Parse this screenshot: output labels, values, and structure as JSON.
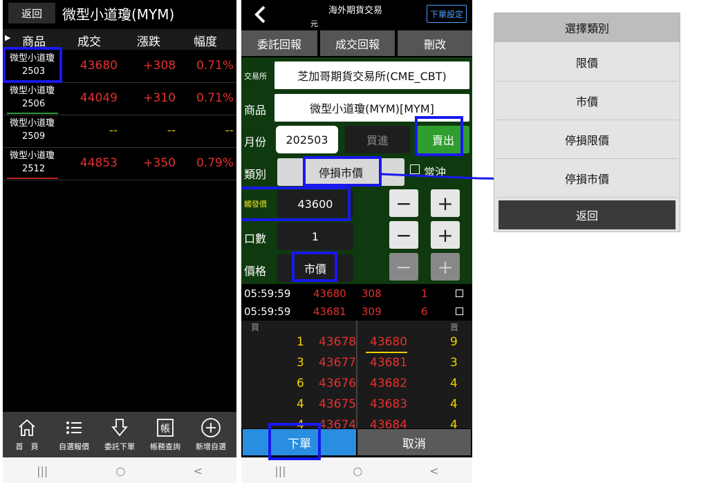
{
  "left": {
    "back_label": "返回",
    "title": "微型小道瓊(MYM)",
    "columns": [
      "商品",
      "成交",
      "漲跌",
      "幅度"
    ],
    "rows": [
      {
        "name": "微型小道瓊",
        "month": "2503",
        "price": "43680",
        "change": "+308",
        "pct": "0.71%"
      },
      {
        "name": "微型小道瓊",
        "month": "2506",
        "price": "44049",
        "change": "+310",
        "pct": "0.71%"
      },
      {
        "name": "微型小道瓊",
        "month": "2509",
        "price": "--",
        "change": "--",
        "pct": "--"
      },
      {
        "name": "微型小道瓊",
        "month": "2512",
        "price": "44853",
        "change": "+350",
        "pct": "0.79%"
      }
    ],
    "nav": [
      {
        "label": "首　頁",
        "icon": "home-icon"
      },
      {
        "label": "自選報價",
        "icon": "list-icon"
      },
      {
        "label": "委託下單",
        "icon": "order-icon"
      },
      {
        "label": "帳務查詢",
        "icon": "account-icon"
      },
      {
        "label": "新增自選",
        "icon": "plus-circle-icon"
      }
    ],
    "sys": [
      "|||",
      "○",
      "<"
    ]
  },
  "middle": {
    "title": "海外期貨交易",
    "currency": "元",
    "settings_label": "下單設定",
    "tabs": [
      "委託回報",
      "成交回報",
      "刪改"
    ],
    "exchange_label": "交易所",
    "exchange_value": "芝加哥期貨交易所(CME_CBT)",
    "product_label": "商品",
    "product_value": "微型小道瓊(MYM)[MYM]",
    "month_label": "月份",
    "month_value": "202503",
    "buy_label": "買進",
    "sell_label": "賣出",
    "type_label": "類別",
    "type_value": "停損市價",
    "daytrade_label": "當沖",
    "trigger_label": "觸發價",
    "trigger_value": "43600",
    "qty_label": "口數",
    "qty_value": "1",
    "price_label": "價格",
    "price_value": "市價",
    "ticks": [
      {
        "time": "05:59:59",
        "price": "43680",
        "chg": "308",
        "vol": "1"
      },
      {
        "time": "05:59:59",
        "price": "43681",
        "chg": "309",
        "vol": "6"
      }
    ],
    "book_buy_label": "買",
    "book_sell_label": "賣",
    "book": [
      {
        "bq": "1",
        "bp": "43678",
        "ap": "43680",
        "aq": "9"
      },
      {
        "bq": "3",
        "bp": "43677",
        "ap": "43681",
        "aq": "3"
      },
      {
        "bq": "6",
        "bp": "43676",
        "ap": "43682",
        "aq": "4"
      },
      {
        "bq": "4",
        "bp": "43675",
        "ap": "43683",
        "aq": "4"
      },
      {
        "bq": "4",
        "bp": "43674",
        "ap": "43684",
        "aq": "4"
      }
    ],
    "submit_label": "下單",
    "cancel_label": "取消",
    "sys": [
      "|||",
      "○",
      "<"
    ]
  },
  "dialog": {
    "title": "選擇類別",
    "options": [
      "限價",
      "市價",
      "停損限價",
      "停損市價"
    ],
    "back_label": "返回"
  }
}
